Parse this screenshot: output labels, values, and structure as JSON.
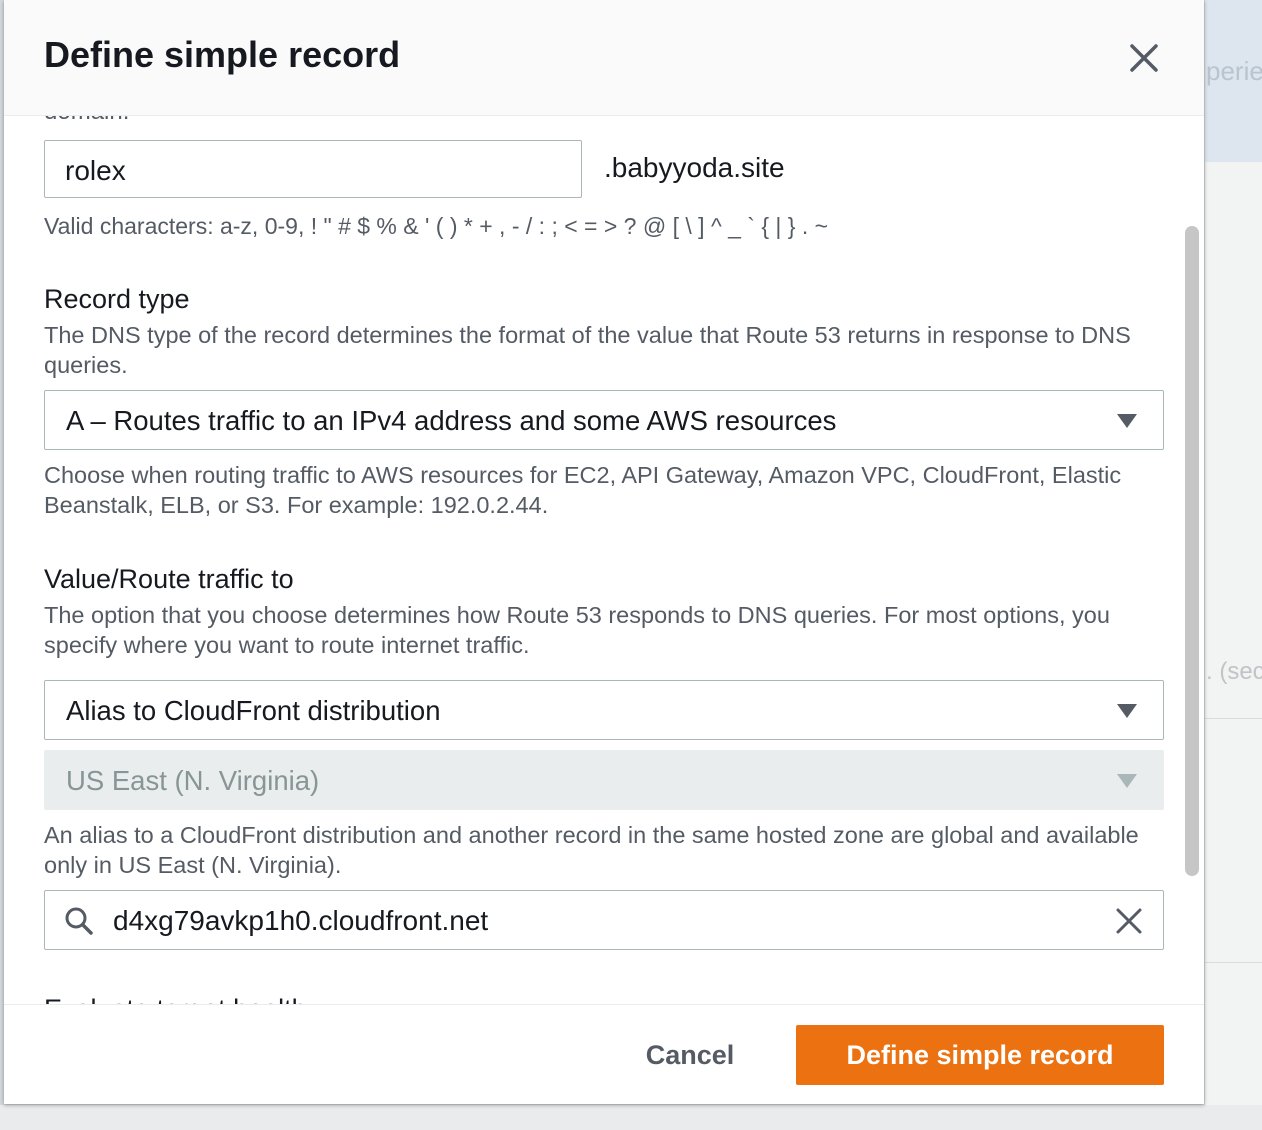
{
  "background": {
    "top_right_text": "perie",
    "mid_right_text": ". (sec"
  },
  "modal": {
    "title": "Define simple record",
    "close_icon": "close-icon",
    "clipped_text_top": "domain.",
    "record_name": {
      "value": "rolex",
      "suffix": ".babyyoda.site",
      "hint": "Valid characters: a-z, 0-9, ! \" # $ % & ' ( ) * + , - / : ; < = > ? @ [ \\ ] ^ _ ` { | } . ~"
    },
    "record_type": {
      "label": "Record type",
      "description": "The DNS type of the record determines the format of the value that Route 53 returns in response to DNS queries.",
      "selected": "A – Routes traffic to an IPv4 address and some AWS resources",
      "hint": "Choose when routing traffic to AWS resources for EC2, API Gateway, Amazon VPC, CloudFront, Elastic Beanstalk, ELB, or S3. For example: 192.0.2.44."
    },
    "value_route": {
      "label": "Value/Route traffic to",
      "description": "The option that you choose determines how Route 53 responds to DNS queries. For most options, you specify where you want to route internet traffic.",
      "endpoint_selected": "Alias to CloudFront distribution",
      "region_selected": "US East (N. Virginia)",
      "region_hint": "An alias to a CloudFront distribution and another record in the same hosted zone are global and available only in US East (N. Virginia).",
      "distribution_value": "d4xg79avkp1h0.cloudfront.net",
      "search_icon": "search-icon",
      "clear_icon": "clear-icon"
    },
    "clipped_label_bottom": "Evaluate target health",
    "footer": {
      "cancel_label": "Cancel",
      "submit_label": "Define simple record"
    }
  }
}
